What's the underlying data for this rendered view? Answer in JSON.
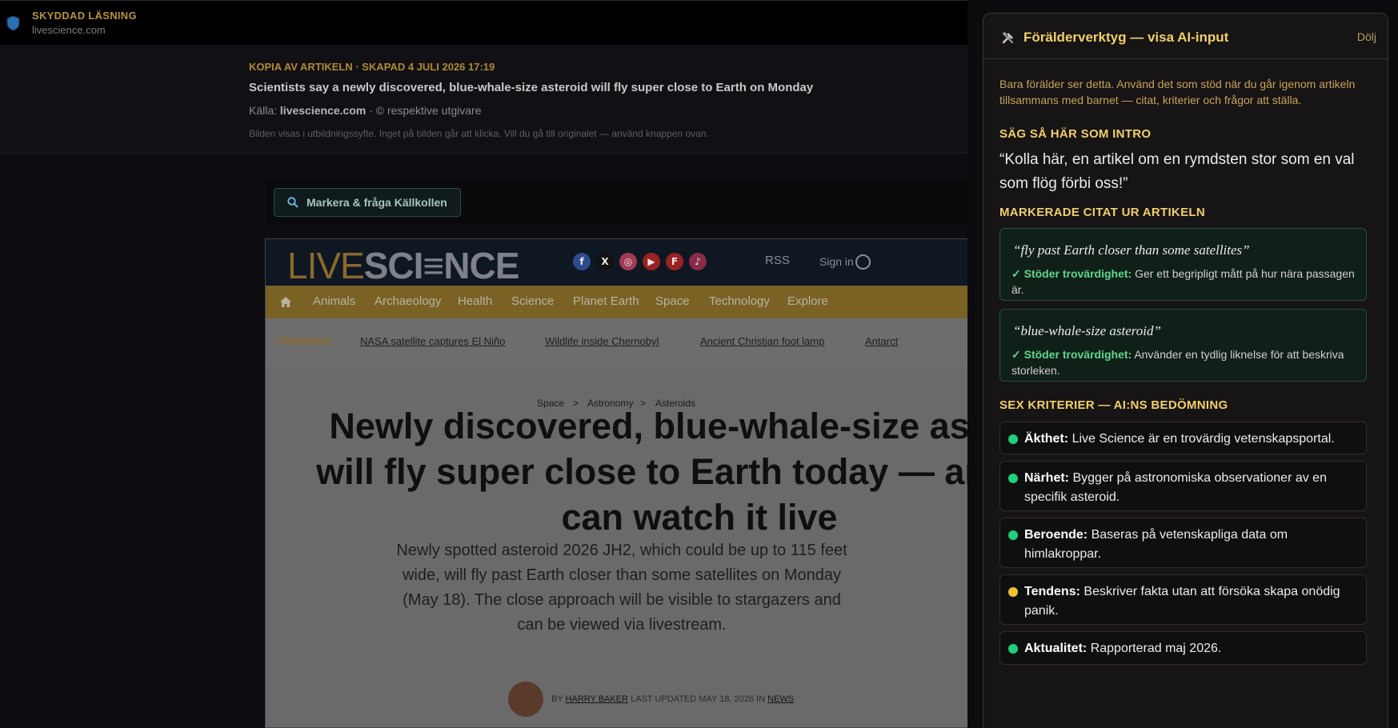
{
  "secure": {
    "title": "SKYDDAD LÄSNING",
    "domain": "livescience.com"
  },
  "copy": {
    "meta": "KOPIA AV ARTIKELN · SKAPAD 4 JULI 2026 17:19",
    "headline": "Scientists say a newly discovered, blue-whale-size asteroid will fly super close to Earth on Monday",
    "source_prefix": "Källa:",
    "source_domain": "livescience.com",
    "source_suffix": "· © respektive utgivare",
    "note": "Bilden visas i utbildningssyfte. Inget på bilden går att klicka. Vill du gå till originalet — använd knappen ovan."
  },
  "ask_button": "Markera & fråga Källkollen",
  "site": {
    "logo_live": "LIVE",
    "logo_science": "SCI≡NCE",
    "rss": "RSS",
    "signin": "Sign in",
    "social": [
      {
        "icon": "facebook-icon",
        "glyph": "f",
        "color": "#2d4a8a"
      },
      {
        "icon": "x-icon",
        "glyph": "X",
        "color": "#111111"
      },
      {
        "icon": "instagram-icon",
        "glyph": "◎",
        "color": "#a23a54"
      },
      {
        "icon": "youtube-icon",
        "glyph": "▶",
        "color": "#9a2222"
      },
      {
        "icon": "flipboard-icon",
        "glyph": "F",
        "color": "#9a2222"
      },
      {
        "icon": "tiktok-icon",
        "glyph": "♪",
        "color": "#8a2a4a"
      }
    ],
    "nav": [
      "Animals",
      "Archaeology",
      "Health",
      "Science",
      "Planet Earth",
      "Space",
      "Technology",
      "Explore"
    ],
    "trending_label": "TRENDING",
    "trending": [
      "NASA satellite captures El Niño",
      "Wildlife inside Chernobyl",
      "Ancient Christian foot lamp",
      "Antarct"
    ],
    "breadcrumb": [
      "Space",
      ">",
      "Astronomy",
      ">",
      "Asteroids"
    ],
    "headline": "Newly discovered, blue-whale-size asteroid will fly super close to Earth today — and you can watch it live",
    "deck": "Newly spotted asteroid 2026 JH2, which could be up to 115 feet wide, will fly past Earth closer than some satellites on Monday (May 18). The close approach will be visible to stargazers and can be viewed via livestream.",
    "byline_by": "BY",
    "byline_author": "HARRY BAKER",
    "byline_updated": "LAST UPDATED MAY 18, 2026",
    "byline_in": "IN",
    "byline_section": "NEWS"
  },
  "panel": {
    "title": "Förälderverktyg — visa AI-input",
    "hide": "Dölj",
    "intro": "Bara förälder ser detta. Använd det som stöd när du går igenom artikeln tillsammans med barnet — citat, kriterier och frågor att ställa.",
    "intro_head": "SÄG SÅ HÄR SOM INTRO",
    "intro_quote": "“Kolla här, en artikel om en rymdsten stor som en val som flög förbi oss!”",
    "quotes_head": "MARKERADE CITAT UR ARTIKELN",
    "quotes": [
      {
        "text": "“fly past Earth closer than some satellites”",
        "label": "✓ Stöder trovärdighet:",
        "note": "Ger ett begripligt mått på hur nära passagen är."
      },
      {
        "text": "“blue-whale-size asteroid”",
        "label": "✓ Stöder trovärdighet:",
        "note": "Använder en tydlig liknelse för att beskriva storleken."
      }
    ],
    "criteria_head": "SEX KRITERIER — AI:NS BEDÖMNING",
    "criteria": [
      {
        "name": "Äkthet:",
        "text": "Live Science är en trovärdig vetenskapsportal.",
        "status": "green"
      },
      {
        "name": "Närhet:",
        "text": "Bygger på astronomiska observationer av en specifik asteroid.",
        "status": "green"
      },
      {
        "name": "Beroende:",
        "text": "Baseras på vetenskapliga data om himlakroppar.",
        "status": "green"
      },
      {
        "name": "Tendens:",
        "text": "Beskriver fakta utan att försöka skapa onödig panik.",
        "status": "yellow"
      },
      {
        "name": "Aktualitet:",
        "text": "Rapporterad maj 2026.",
        "status": "green"
      }
    ],
    "colors": {
      "green": "#1fcf7a",
      "yellow": "#f2c230"
    }
  }
}
